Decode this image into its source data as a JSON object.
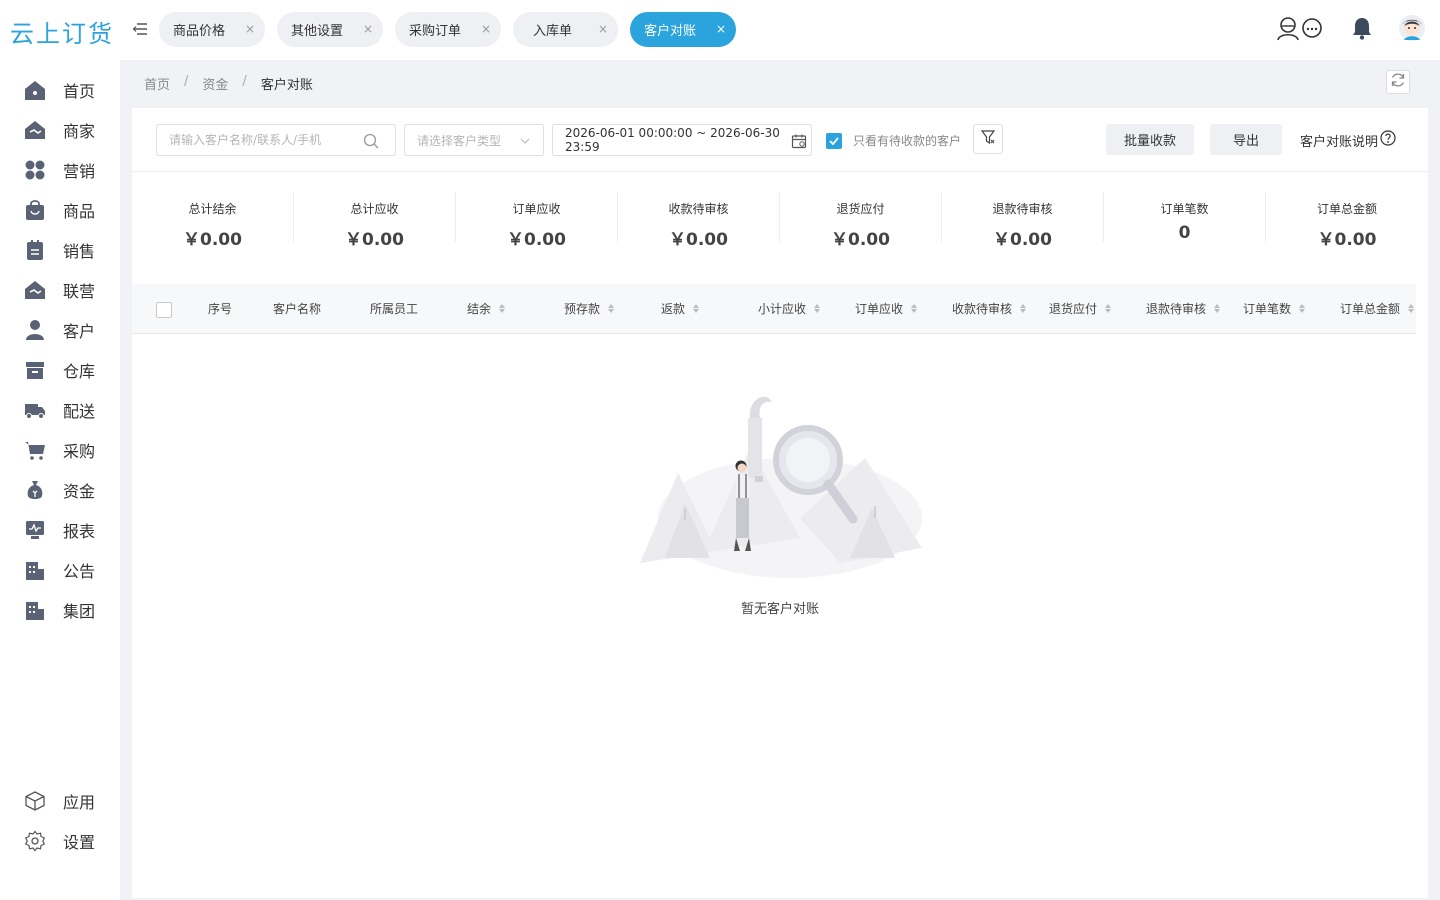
{
  "app": {
    "logo": "云上订货"
  },
  "tabs": [
    {
      "label": "商品价格",
      "active": false
    },
    {
      "label": "其他设置",
      "active": false
    },
    {
      "label": "采购订单",
      "active": false
    },
    {
      "label": "入库单",
      "active": false
    },
    {
      "label": "客户对账",
      "active": true
    }
  ],
  "tab_close": "×",
  "top_icons": [
    "support-icon",
    "bell-icon",
    "avatar"
  ],
  "sidebar": {
    "items": [
      {
        "label": "首页",
        "icon": "home-icon"
      },
      {
        "label": "商家",
        "icon": "store-icon"
      },
      {
        "label": "营销",
        "icon": "marketing-icon"
      },
      {
        "label": "商品",
        "icon": "bag-icon"
      },
      {
        "label": "销售",
        "icon": "sales-icon"
      },
      {
        "label": "联营",
        "icon": "alliance-icon"
      },
      {
        "label": "客户",
        "icon": "user-icon"
      },
      {
        "label": "仓库",
        "icon": "warehouse-icon"
      },
      {
        "label": "配送",
        "icon": "truck-icon"
      },
      {
        "label": "采购",
        "icon": "cart-icon"
      },
      {
        "label": "资金",
        "icon": "money-icon"
      },
      {
        "label": "报表",
        "icon": "report-icon"
      },
      {
        "label": "公告",
        "icon": "notice-icon"
      },
      {
        "label": "集团",
        "icon": "group-icon"
      }
    ],
    "bottom": [
      {
        "label": "应用",
        "icon": "cube-icon"
      },
      {
        "label": "设置",
        "icon": "gear-icon"
      }
    ]
  },
  "breadcrumb": {
    "home": "首页",
    "sep": "/",
    "parent": "资金",
    "current": "客户对账"
  },
  "filters": {
    "search_placeholder": "请输入客户名称/联系人/手机",
    "customer_type_placeholder": "请选择客户类型",
    "date_range": "2026-06-01 00:00:00 ~ 2026-06-30 23:59",
    "only_pending_label": "只看有待收款的客户",
    "only_pending_checked": true,
    "batch_collect": "批量收款",
    "export": "导出",
    "explain": "客户对账说明"
  },
  "stats": [
    {
      "label": "总计结余",
      "value": "￥0.00"
    },
    {
      "label": "总计应收",
      "value": "￥0.00"
    },
    {
      "label": "订单应收",
      "value": "￥0.00"
    },
    {
      "label": "收款待审核",
      "value": "￥0.00"
    },
    {
      "label": "退货应付",
      "value": "￥0.00"
    },
    {
      "label": "退款待审核",
      "value": "￥0.00"
    },
    {
      "label": "订单笔数",
      "value": "0"
    },
    {
      "label": "订单总金额",
      "value": "￥0.00"
    }
  ],
  "table": {
    "columns": [
      {
        "label": "序号",
        "sortable": false
      },
      {
        "label": "客户名称",
        "sortable": false
      },
      {
        "label": "所属员工",
        "sortable": false
      },
      {
        "label": "结余",
        "sortable": true
      },
      {
        "label": "预存款",
        "sortable": true
      },
      {
        "label": "返款",
        "sortable": true
      },
      {
        "label": "小计应收",
        "sortable": true
      },
      {
        "label": "订单应收",
        "sortable": true
      },
      {
        "label": "收款待审核",
        "sortable": true
      },
      {
        "label": "退货应付",
        "sortable": true
      },
      {
        "label": "退款待审核",
        "sortable": true
      },
      {
        "label": "订单笔数",
        "sortable": true
      },
      {
        "label": "订单总金额",
        "sortable": true
      }
    ],
    "rows": [],
    "empty_text": "暂无客户对账"
  },
  "colors": {
    "accent": "#2ba3dc",
    "nav_icon": "#5a6275",
    "bg": "#f0f2f5"
  }
}
